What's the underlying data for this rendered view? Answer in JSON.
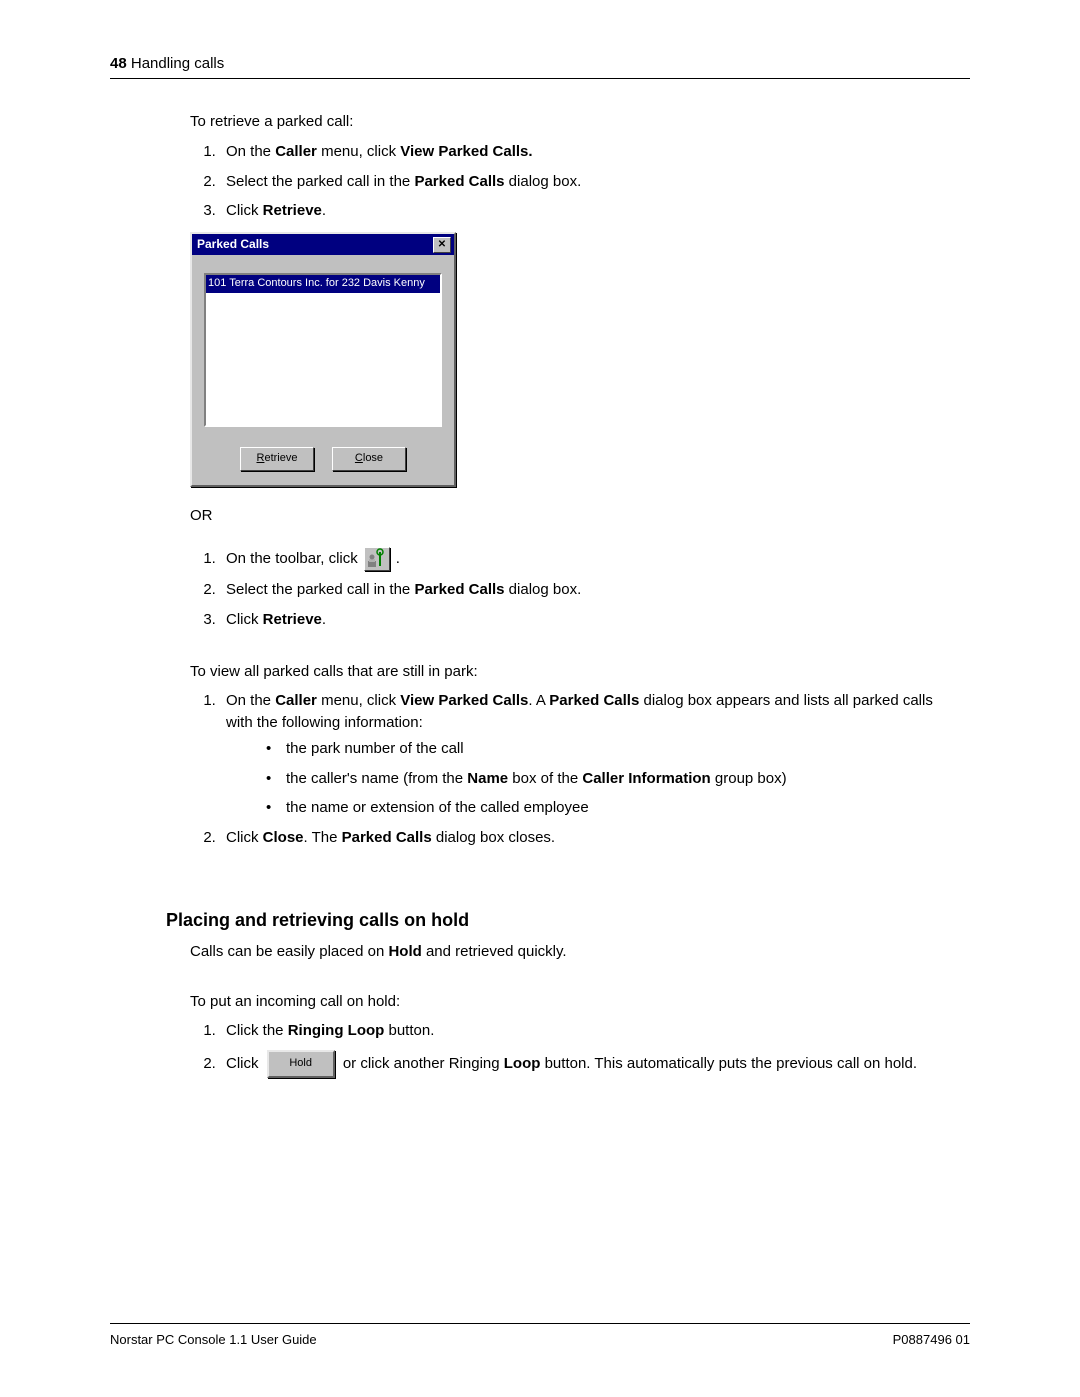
{
  "header": {
    "page_number": "48",
    "section": " Handling calls"
  },
  "intro_retrieve": "To retrieve a parked call:",
  "steps_retrieve": {
    "s1_a": "On the ",
    "s1_b": "Caller",
    "s1_c": " menu, click ",
    "s1_d": "View Parked Calls.",
    "s2_a": "Select the parked call in the ",
    "s2_b": "Parked Calls",
    "s2_c": " dialog box.",
    "s3_a": "Click ",
    "s3_b": "Retrieve",
    "s3_c": "."
  },
  "dialog": {
    "title": "Parked Calls",
    "selected_item": "101 Terra Contours Inc.    for 232 Davis Kenny",
    "retrieve_btn_pre": "R",
    "retrieve_btn_rest": "etrieve",
    "close_btn_pre": "C",
    "close_btn_rest": "lose"
  },
  "or_label": "OR",
  "steps_or": {
    "s1_a": "On the toolbar, click ",
    "s1_b": ".",
    "s2_a": "Select the parked call in the ",
    "s2_b": "Parked Calls",
    "s2_c": " dialog box.",
    "s3_a": "Click ",
    "s3_b": "Retrieve",
    "s3_c": "."
  },
  "intro_view": "To view all parked calls that are still in park:",
  "steps_view": {
    "s1_a": "On the ",
    "s1_b": "Caller",
    "s1_c": " menu, click ",
    "s1_d": "View Parked Calls",
    "s1_e": ". A ",
    "s1_f": "Parked Calls",
    "s1_g": " dialog box appears and lists all parked calls with the following information:",
    "b1": "the park number of the call",
    "b2_a": "the caller's name (from the ",
    "b2_b": "Name",
    "b2_c": " box of the ",
    "b2_d": "Caller Information",
    "b2_e": " group box)",
    "b3": "the name or extension of the called employee",
    "s2_a": "Click ",
    "s2_b": "Close",
    "s2_c": ". The ",
    "s2_d": "Parked Calls",
    "s2_e": " dialog box closes."
  },
  "section_heading": "Placing and retrieving calls on hold",
  "hold_intro_a": "Calls can be easily placed on ",
  "hold_intro_b": "Hold",
  "hold_intro_c": " and retrieved quickly.",
  "intro_put_hold": "To put an incoming call on hold:",
  "steps_hold": {
    "s1_a": "Click the ",
    "s1_b": "Ringing Loop",
    "s1_c": " button.",
    "s2_a": "Click ",
    "s2_b": " or click another Ringing ",
    "s2_c": "Loop",
    "s2_d": " button. This automatically puts the previous call on hold.",
    "hold_btn_label": "Hold"
  },
  "footer": {
    "left": "Norstar PC Console 1.1 User Guide",
    "right": "P0887496 01"
  }
}
